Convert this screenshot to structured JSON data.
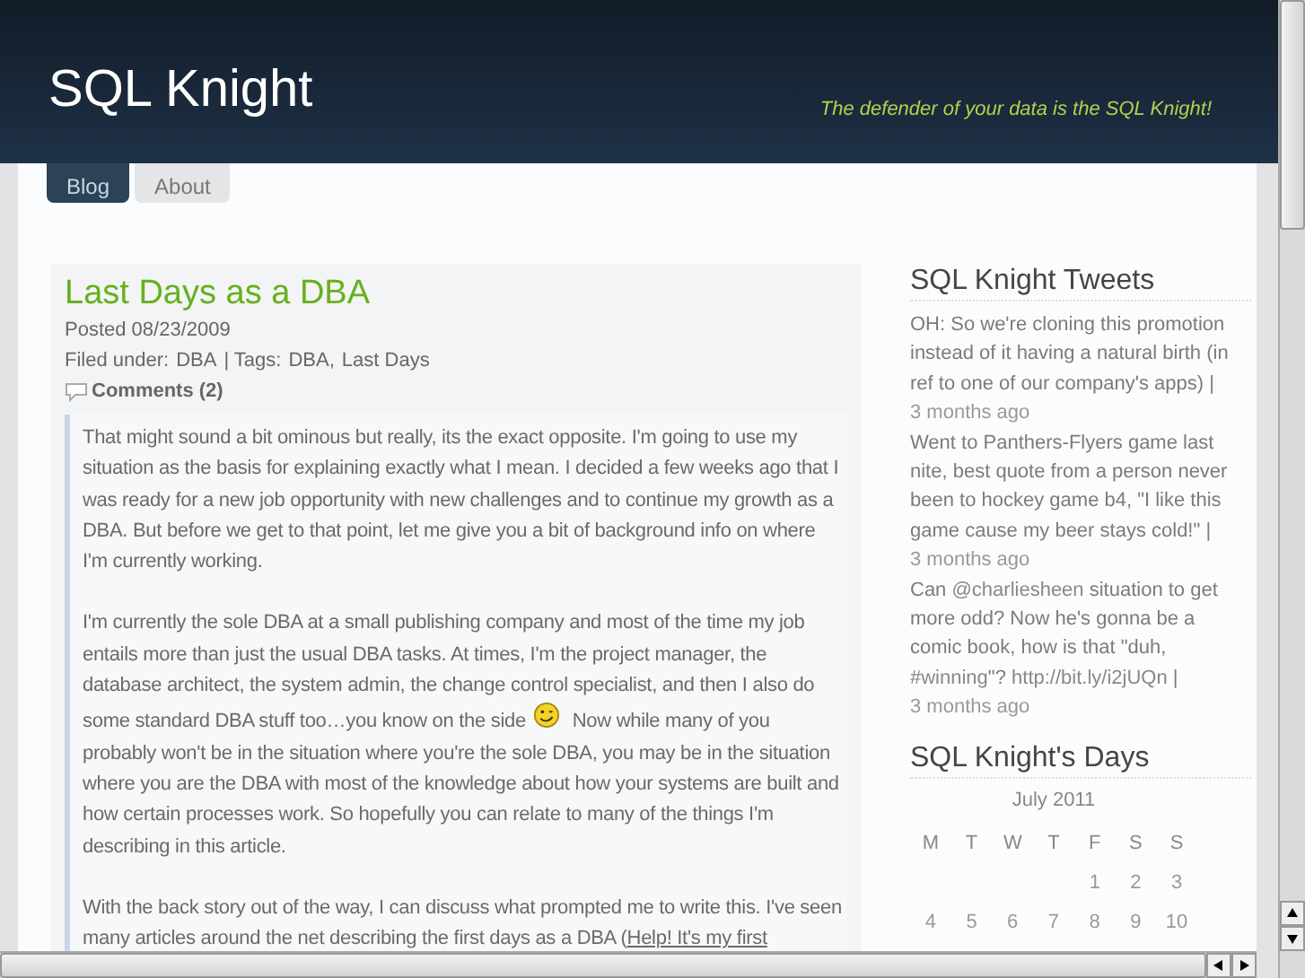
{
  "header": {
    "title": "SQL Knight",
    "tagline": "The defender of your data is the SQL Knight!"
  },
  "tabs": [
    {
      "label": "Blog",
      "selected": true
    },
    {
      "label": "About",
      "selected": false
    }
  ],
  "post": {
    "title": "Last Days as a DBA",
    "posted": "Posted 08/23/2009",
    "filed_label": "Filed under:",
    "filed_link": "DBA",
    "tags_label": "| Tags:",
    "tags": [
      "DBA,",
      "Last Days"
    ],
    "comments": "Comments (2)",
    "paragraphs": [
      [
        {
          "kind": "text",
          "text": "That might sound a bit ominous but really, its the exact opposite.  I'm going to use my situation as the basis for explaining exactly what I mean.  I decided a few weeks ago that I was ready for a new job opportunity with new challenges and to continue my growth as a DBA.  But before we get to that point, let me give you a bit of background info on where I'm currently working."
        }
      ],
      [
        {
          "kind": "text",
          "text": "I'm currently the sole DBA at a small publishing company and most of the time my job entails more than just the usual DBA tasks.  At times, I'm the project manager, the database architect, the system admin, the change control specialist, and then I also do some standard DBA stuff too…you know on the side"
        },
        {
          "kind": "smiley"
        },
        {
          "kind": "text",
          "text": "  Now while many of you probably won't be in the situation where you're the sole DBA, you may be in the situation where you are the DBA with most of the knowledge about how your systems are built and how certain processes work.  So hopefully you can relate to many of the things I'm describing  in this article."
        }
      ],
      [
        {
          "kind": "text",
          "text": "With the back story out of the way, I can discuss what prompted me to write this.  I've seen many articles around the net describing the first days as a DBA ("
        },
        {
          "kind": "link",
          "text": "Help! It's my first"
        }
      ]
    ]
  },
  "tweets": {
    "title": "SQL Knight Tweets",
    "items": [
      {
        "parts": [
          {
            "kind": "text",
            "text": "OH: So we're cloning this promotion instead of it having a natural birth (in ref to one of our company's apps) |"
          }
        ],
        "time": "3 months ago"
      },
      {
        "parts": [
          {
            "kind": "text",
            "text": "Went to Panthers-Flyers game last nite, best quote from a person never been to hockey game b4, \"I like this game cause my beer stays cold!\" |"
          }
        ],
        "time": "3 months ago"
      },
      {
        "parts": [
          {
            "kind": "text",
            "text": "Can "
          },
          {
            "kind": "link",
            "text": "@charliesheen"
          },
          {
            "kind": "text",
            "text": " situation to get more odd? Now he's gonna be a comic book, how is that \"duh, "
          },
          {
            "kind": "link",
            "text": "#winning"
          },
          {
            "kind": "text",
            "text": "\"? "
          },
          {
            "kind": "link",
            "text": "http://bit.ly/i2jUQn"
          },
          {
            "kind": "text",
            "text": " |"
          }
        ],
        "time": "3 months ago"
      }
    ]
  },
  "calendar": {
    "title": "SQL Knight's Days",
    "month": "July 2011",
    "weekdays": [
      "M",
      "T",
      "W",
      "T",
      "F",
      "S",
      "S"
    ],
    "weeks": [
      {
        "kind": "end_aligned",
        "days": [
          "1",
          "2",
          "3"
        ]
      },
      {
        "kind": "full",
        "days": [
          "4",
          "5",
          "6",
          "7",
          "8",
          "9",
          "10"
        ]
      }
    ]
  }
}
